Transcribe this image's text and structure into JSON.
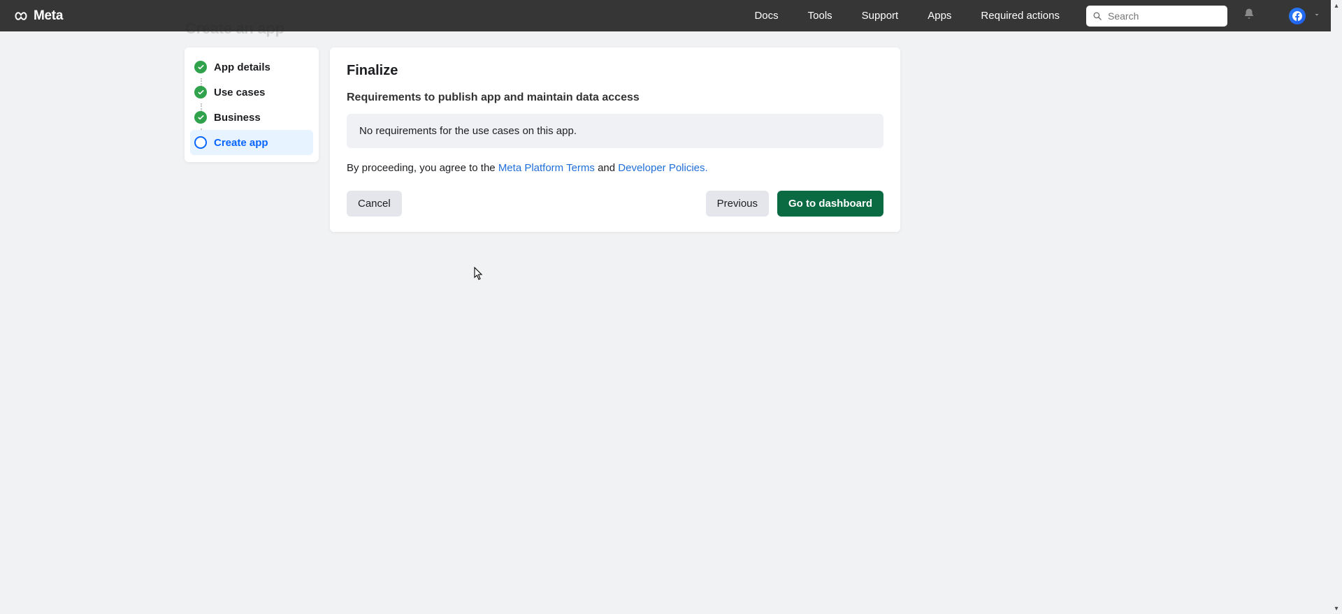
{
  "header": {
    "brand": "Meta",
    "nav": [
      "Docs",
      "Tools",
      "Support",
      "Apps",
      "Required actions"
    ],
    "search_placeholder": "Search"
  },
  "page": {
    "behind_title": "Create an app"
  },
  "steps": [
    {
      "label": "App details",
      "state": "done"
    },
    {
      "label": "Use cases",
      "state": "done"
    },
    {
      "label": "Business",
      "state": "done"
    },
    {
      "label": "Create app",
      "state": "current"
    }
  ],
  "main": {
    "title": "Finalize",
    "subtitle": "Requirements to publish app and maintain data access",
    "requirements_message": "No requirements for the use cases on this app.",
    "legal_prefix": "By proceeding, you agree to the ",
    "legal_link1": "Meta Platform Terms",
    "legal_and": " and ",
    "legal_link2": "Developer Policies.",
    "cancel_label": "Cancel",
    "previous_label": "Previous",
    "go_label": "Go to dashboard"
  }
}
